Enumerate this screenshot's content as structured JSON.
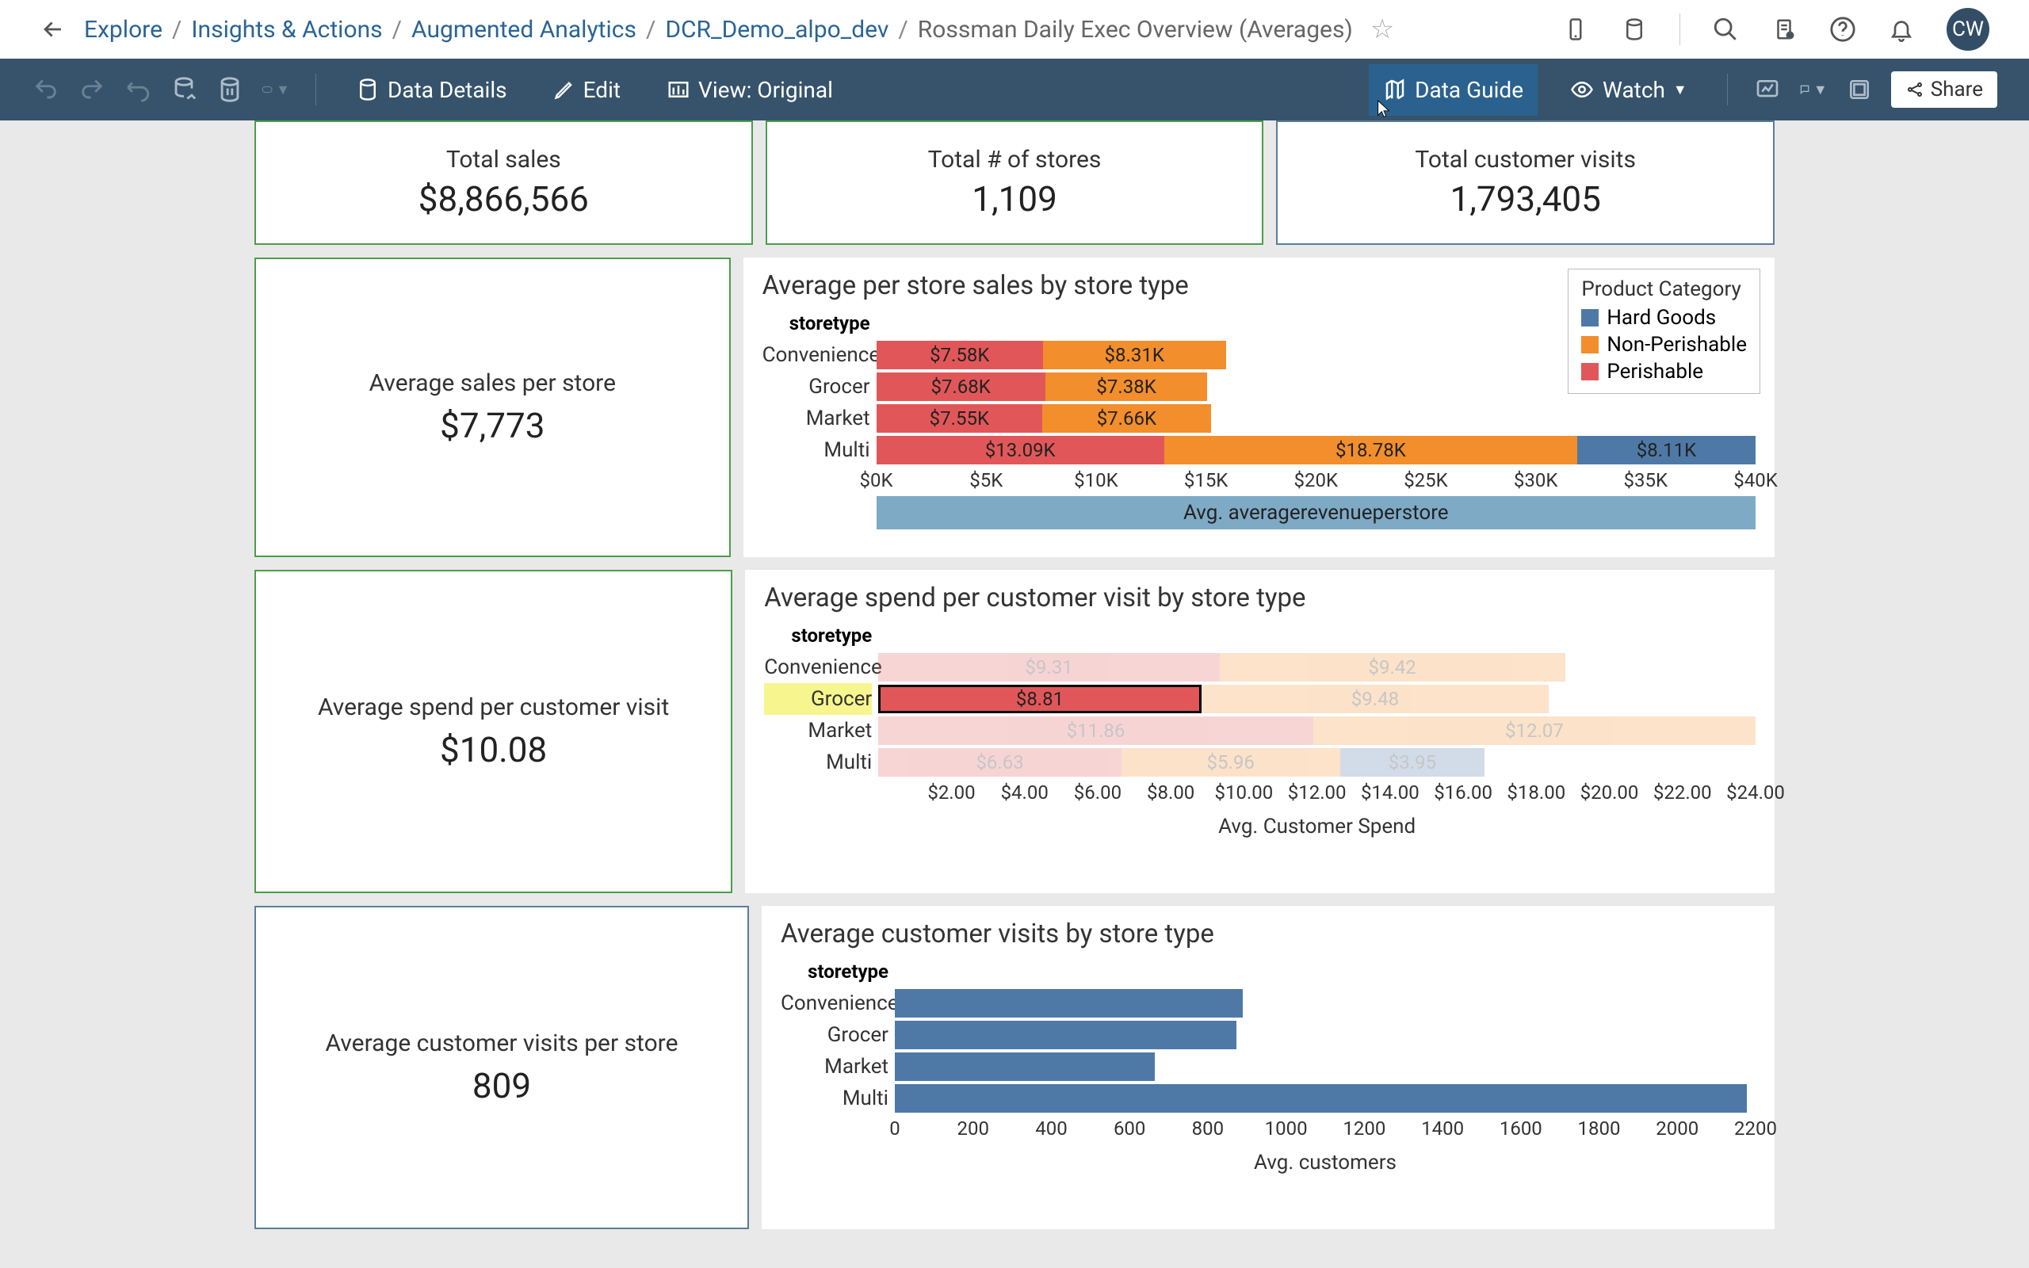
{
  "breadcrumbs": {
    "items": [
      "Explore",
      "Insights & Actions",
      "Augmented Analytics",
      "DCR_Demo_alpo_dev"
    ],
    "current": "Rossman Daily Exec Overview (Averages)"
  },
  "avatar": "CW",
  "toolbar": {
    "data_details": "Data Details",
    "edit": "Edit",
    "view": "View: Original",
    "data_guide": "Data Guide",
    "watch": "Watch",
    "share": "Share"
  },
  "kpis": {
    "top": [
      {
        "title": "Total sales",
        "value": "$8,866,566",
        "color": "green"
      },
      {
        "title": "Total # of stores",
        "value": "1,109",
        "color": "green"
      },
      {
        "title": "Total customer visits",
        "value": "1,793,405",
        "color": "blue"
      }
    ],
    "side": [
      {
        "title": "Average sales per store",
        "value": "$7,773",
        "color": "green"
      },
      {
        "title": "Average spend per customer visit",
        "value": "$10.08",
        "color": "green"
      },
      {
        "title": "Average customer visits per store",
        "value": "809",
        "color": "blue"
      }
    ]
  },
  "legend": {
    "title": "Product Category",
    "items": [
      {
        "label": "Hard Goods",
        "color": "#4e79a7"
      },
      {
        "label": "Non-Perishable",
        "color": "#f28e2b"
      },
      {
        "label": "Perishable",
        "color": "#e15759"
      }
    ]
  },
  "charts": {
    "chart1": {
      "title": "Average per store sales by store type",
      "cat_axis_title": "storetype",
      "xlabel": "Avg. averagerevenueperstore"
    },
    "chart2": {
      "title": "Average spend per customer visit by store type",
      "cat_axis_title": "storetype",
      "xlabel": "Avg. Customer Spend"
    },
    "chart3": {
      "title": "Average customer visits by store type",
      "cat_axis_title": "storetype",
      "xlabel": "Avg. customers"
    }
  },
  "chart_data": [
    {
      "id": "chart1",
      "type": "bar_stacked_horizontal",
      "title": "Average per store sales by store type",
      "categories": [
        "Convenience",
        "Grocer",
        "Market",
        "Multi"
      ],
      "series": [
        {
          "name": "Perishable",
          "values": [
            7580,
            7680,
            7550,
            13090
          ],
          "labels": [
            "$7.58K",
            "$7.68K",
            "$7.55K",
            "$13.09K"
          ]
        },
        {
          "name": "Non-Perishable",
          "values": [
            8310,
            7380,
            7660,
            18780
          ],
          "labels": [
            "$8.31K",
            "$7.38K",
            "$7.66K",
            "$18.78K"
          ]
        },
        {
          "name": "Hard Goods",
          "values": [
            0,
            0,
            0,
            8110
          ],
          "labels": [
            "",
            "",
            "",
            "$8.11K"
          ]
        }
      ],
      "xlim": [
        0,
        40000
      ],
      "xticks": [
        0,
        5000,
        10000,
        15000,
        20000,
        25000,
        30000,
        35000,
        40000
      ],
      "xtick_labels": [
        "$0K",
        "$5K",
        "$10K",
        "$15K",
        "$20K",
        "$25K",
        "$30K",
        "$35K",
        "$40K"
      ],
      "xlabel": "Avg. averagerevenueperstore"
    },
    {
      "id": "chart2",
      "type": "bar_stacked_horizontal",
      "title": "Average spend per customer visit by store type",
      "categories": [
        "Convenience",
        "Grocer",
        "Market",
        "Multi"
      ],
      "highlighted_category": "Grocer",
      "highlighted_series": "Perishable",
      "series": [
        {
          "name": "Perishable",
          "values": [
            9.31,
            8.81,
            11.86,
            6.63
          ],
          "labels": [
            "$9.31",
            "$8.81",
            "$11.86",
            "$6.63"
          ]
        },
        {
          "name": "Non-Perishable",
          "values": [
            9.42,
            9.48,
            12.07,
            5.96
          ],
          "labels": [
            "$9.42",
            "$9.48",
            "$12.07",
            "$5.96"
          ]
        },
        {
          "name": "Hard Goods",
          "values": [
            0,
            0,
            0,
            3.95
          ],
          "labels": [
            "",
            "",
            "",
            "$3.95"
          ]
        }
      ],
      "xlim": [
        0,
        24
      ],
      "xticks": [
        2,
        4,
        6,
        8,
        10,
        12,
        14,
        16,
        18,
        20,
        22,
        24
      ],
      "xtick_labels": [
        "$2.00",
        "$4.00",
        "$6.00",
        "$8.00",
        "$10.00",
        "$12.00",
        "$14.00",
        "$16.00",
        "$18.00",
        "$20.00",
        "$22.00",
        "$24.00"
      ],
      "xlabel": "Avg. Customer Spend"
    },
    {
      "id": "chart3",
      "type": "bar_horizontal",
      "title": "Average customer visits by store type",
      "categories": [
        "Convenience",
        "Grocer",
        "Market",
        "Multi"
      ],
      "values": [
        870,
        855,
        650,
        2130
      ],
      "xlim": [
        0,
        2200
      ],
      "xticks": [
        0,
        200,
        400,
        600,
        800,
        1000,
        1200,
        1400,
        1600,
        1800,
        2000,
        2200
      ],
      "xlabel": "Avg. customers"
    }
  ]
}
